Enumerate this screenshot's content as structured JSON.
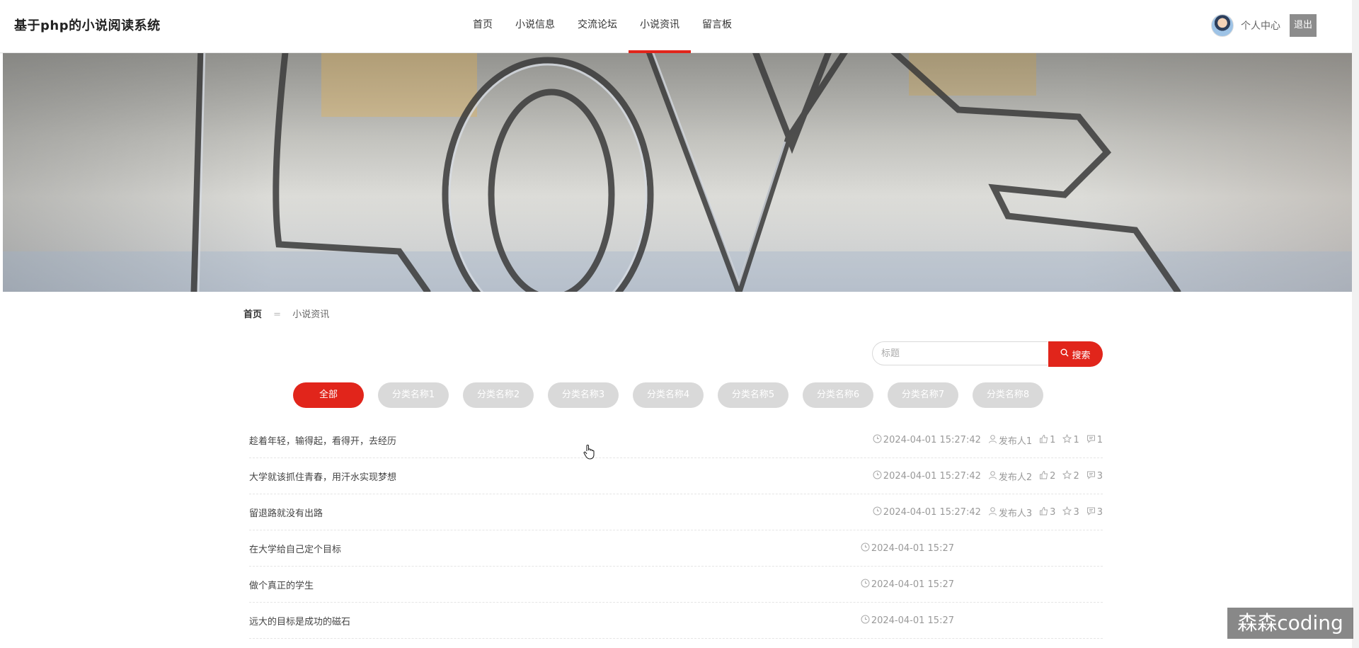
{
  "header": {
    "site_title": "基于php的小说阅读系统",
    "nav": [
      "首页",
      "小说信息",
      "交流论坛",
      "小说资讯",
      "留言板"
    ],
    "active_nav": "小说资讯",
    "user_center_label": "个人中心",
    "logout_label": "退出"
  },
  "banner": {
    "slide_count": 2,
    "active_slide": 2
  },
  "breadcrumb": {
    "home": "首页",
    "separator": "=",
    "current": "小说资讯"
  },
  "search": {
    "placeholder": "标题",
    "value": "",
    "button_label": "搜索"
  },
  "categories": {
    "items": [
      "全部",
      "分类名称1",
      "分类名称2",
      "分类名称3",
      "分类名称4",
      "分类名称5",
      "分类名称6",
      "分类名称7",
      "分类名称8"
    ],
    "active": "全部"
  },
  "news": [
    {
      "title": "趁着年轻，输得起，看得开，去经历",
      "date": "2024-04-01 15:27:42",
      "publisher": "发布人1",
      "likes": "1",
      "favorites": "1",
      "comments": "1"
    },
    {
      "title": "大学就该抓住青春，用汗水实现梦想",
      "date": "2024-04-01 15:27:42",
      "publisher": "发布人2",
      "likes": "2",
      "favorites": "2",
      "comments": "3"
    },
    {
      "title": "留退路就没有出路",
      "date": "2024-04-01 15:27:42",
      "publisher": "发布人3",
      "likes": "3",
      "favorites": "3",
      "comments": "3"
    },
    {
      "title": "在大学给自己定个目标",
      "date": "2024-04-01 15:27"
    },
    {
      "title": "做个真正的学生",
      "date": "2024-04-01 15:27"
    },
    {
      "title": "远大的目标是成功的磁石",
      "date": "2024-04-01 15:27"
    }
  ],
  "icons": {
    "date": "clock-icon",
    "publisher": "user-icon",
    "likes": "thumbs-up-icon",
    "favorites": "star-icon",
    "comments": "comment-icon",
    "search": "search-icon"
  },
  "colors": {
    "accent": "#e1251b",
    "inactive_category": "#d9d9d9",
    "logout": "#8c8c8c"
  },
  "watermark": "森森coding"
}
